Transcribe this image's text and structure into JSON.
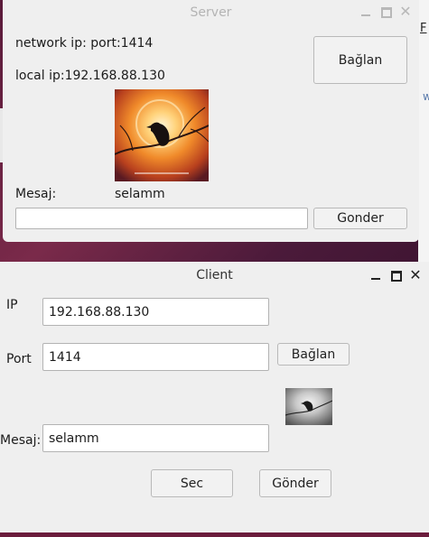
{
  "desktop": {
    "partial_letter_top": "F",
    "partial_letter_mid": "w"
  },
  "server": {
    "title": "Server",
    "network_ip": "network ip: port:1414",
    "local_ip": "local ip:192.168.88.130",
    "connect_label": "Bağlan",
    "message_label": "Mesaj:",
    "message_value": "selamm",
    "input_value": "",
    "send_label": "Gonder"
  },
  "client": {
    "title": "Client",
    "ip_label": "IP",
    "ip_value": "192.168.88.130",
    "port_label": "Port",
    "port_value": "1414",
    "connect_label": "Bağlan",
    "message_label": "Mesaj:",
    "message_value": "selamm",
    "select_label": "Sec",
    "send_label": "Gönder"
  }
}
